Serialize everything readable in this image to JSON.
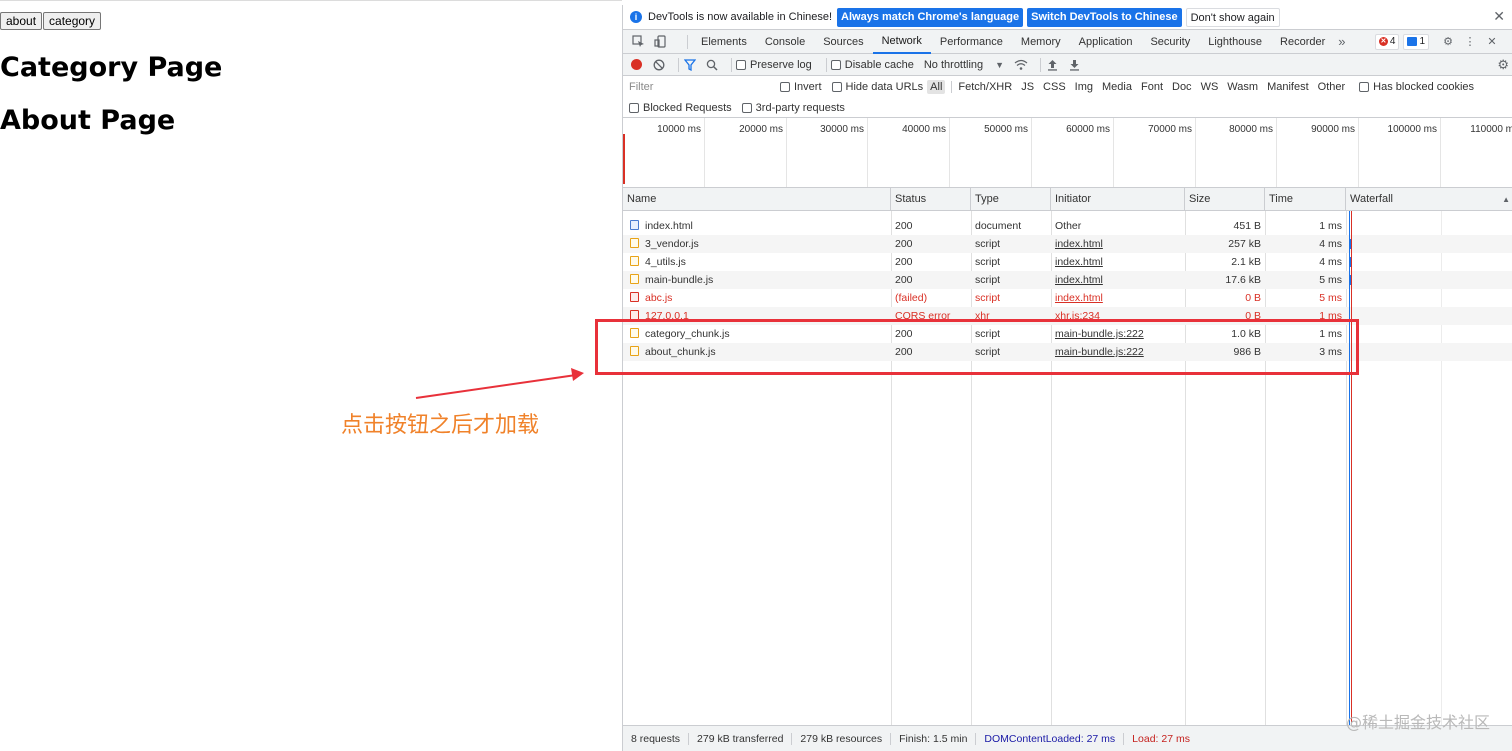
{
  "page": {
    "buttons": {
      "about": "about",
      "category": "category"
    },
    "heading_category": "Category Page",
    "heading_about": "About Page"
  },
  "annotation": {
    "text": "点击按钮之后才加载",
    "color": "#f0822a",
    "box_color": "#e8313a"
  },
  "devtools": {
    "infobar": {
      "message": "DevTools is now available in Chinese!",
      "btn_match": "Always match Chrome's language",
      "btn_switch": "Switch DevTools to Chinese",
      "btn_dismiss": "Don't show again"
    },
    "tabs": [
      "Elements",
      "Console",
      "Sources",
      "Network",
      "Performance",
      "Memory",
      "Application",
      "Security",
      "Lighthouse",
      "Recorder"
    ],
    "active_tab": "Network",
    "more_tabs": "»",
    "error_count": "4",
    "message_count": "1",
    "toolbar": {
      "preserve_log": "Preserve log",
      "disable_cache": "Disable cache",
      "throttling": "No throttling"
    },
    "filter": {
      "placeholder": "Filter",
      "invert": "Invert",
      "hide_data_urls": "Hide data URLs",
      "types": [
        "All",
        "Fetch/XHR",
        "JS",
        "CSS",
        "Img",
        "Media",
        "Font",
        "Doc",
        "WS",
        "Wasm",
        "Manifest",
        "Other"
      ],
      "has_blocked_cookies": "Has blocked cookies",
      "blocked_requests": "Blocked Requests",
      "third_party": "3rd-party requests"
    },
    "overview_ticks": [
      "10000 ms",
      "20000 ms",
      "30000 ms",
      "40000 ms",
      "50000 ms",
      "60000 ms",
      "70000 ms",
      "80000 ms",
      "90000 ms",
      "100000 ms",
      "110000 ms"
    ],
    "columns": {
      "name": "Name",
      "status": "Status",
      "type": "Type",
      "initiator": "Initiator",
      "size": "Size",
      "time": "Time",
      "waterfall": "Waterfall"
    },
    "requests": [
      {
        "name": "index.html",
        "status": "200",
        "type": "document",
        "initiator": "Other",
        "size": "451 B",
        "time": "1 ms",
        "icon": "document-icon",
        "failed": false,
        "link": false
      },
      {
        "name": "3_vendor.js",
        "status": "200",
        "type": "script",
        "initiator": "index.html",
        "size": "257 kB",
        "time": "4 ms",
        "icon": "script-icon",
        "failed": false,
        "link": true
      },
      {
        "name": "4_utils.js",
        "status": "200",
        "type": "script",
        "initiator": "index.html",
        "size": "2.1 kB",
        "time": "4 ms",
        "icon": "script-icon",
        "failed": false,
        "link": true
      },
      {
        "name": "main-bundle.js",
        "status": "200",
        "type": "script",
        "initiator": "index.html",
        "size": "17.6 kB",
        "time": "5 ms",
        "icon": "script-icon",
        "failed": false,
        "link": true
      },
      {
        "name": "abc.js",
        "status": "(failed)",
        "type": "script",
        "initiator": "index.html",
        "size": "0 B",
        "time": "5 ms",
        "icon": "error-icon",
        "failed": true,
        "link": true
      },
      {
        "name": "127.0.0.1",
        "status": "CORS error",
        "type": "xhr",
        "initiator": "xhr.js:234",
        "size": "0 B",
        "time": "1 ms",
        "icon": "error-icon",
        "failed": true,
        "link": true
      },
      {
        "name": "category_chunk.js",
        "status": "200",
        "type": "script",
        "initiator": "main-bundle.js:222",
        "size": "1.0 kB",
        "time": "1 ms",
        "icon": "script-icon",
        "failed": false,
        "link": true
      },
      {
        "name": "about_chunk.js",
        "status": "200",
        "type": "script",
        "initiator": "main-bundle.js:222",
        "size": "986 B",
        "time": "3 ms",
        "icon": "script-icon",
        "failed": false,
        "link": true
      }
    ],
    "status": {
      "requests": "8 requests",
      "transferred": "279 kB transferred",
      "resources": "279 kB resources",
      "finish": "Finish: 1.5 min",
      "dom_content_loaded": "DOMContentLoaded: 27 ms",
      "load": "Load: 27 ms"
    },
    "colors": {
      "accent": "#1a73e8",
      "error": "#d93025"
    }
  },
  "watermark": "@稀土掘金技术社区"
}
